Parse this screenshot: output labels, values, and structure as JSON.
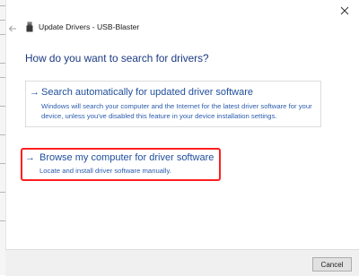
{
  "window": {
    "title": "Update Drivers - USB-Blaster",
    "close_icon": "close-icon",
    "back_icon": "back-arrow-icon",
    "device_icon": "usb-device-icon"
  },
  "main": {
    "heading": "How do you want to search for drivers?"
  },
  "options": [
    {
      "arrow": "→",
      "title": "Search automatically for updated driver software",
      "description": "Windows will search your computer and the Internet for the latest driver software for your device, unless you've disabled this feature in your device installation settings."
    },
    {
      "arrow": "→",
      "title": "Browse my computer for driver software",
      "description": "Locate and install driver software manually."
    }
  ],
  "footer": {
    "cancel_label": "Cancel"
  },
  "colors": {
    "heading": "#1b3a82",
    "link": "#1f4e9c",
    "highlight_border": "#ff1f1f"
  }
}
